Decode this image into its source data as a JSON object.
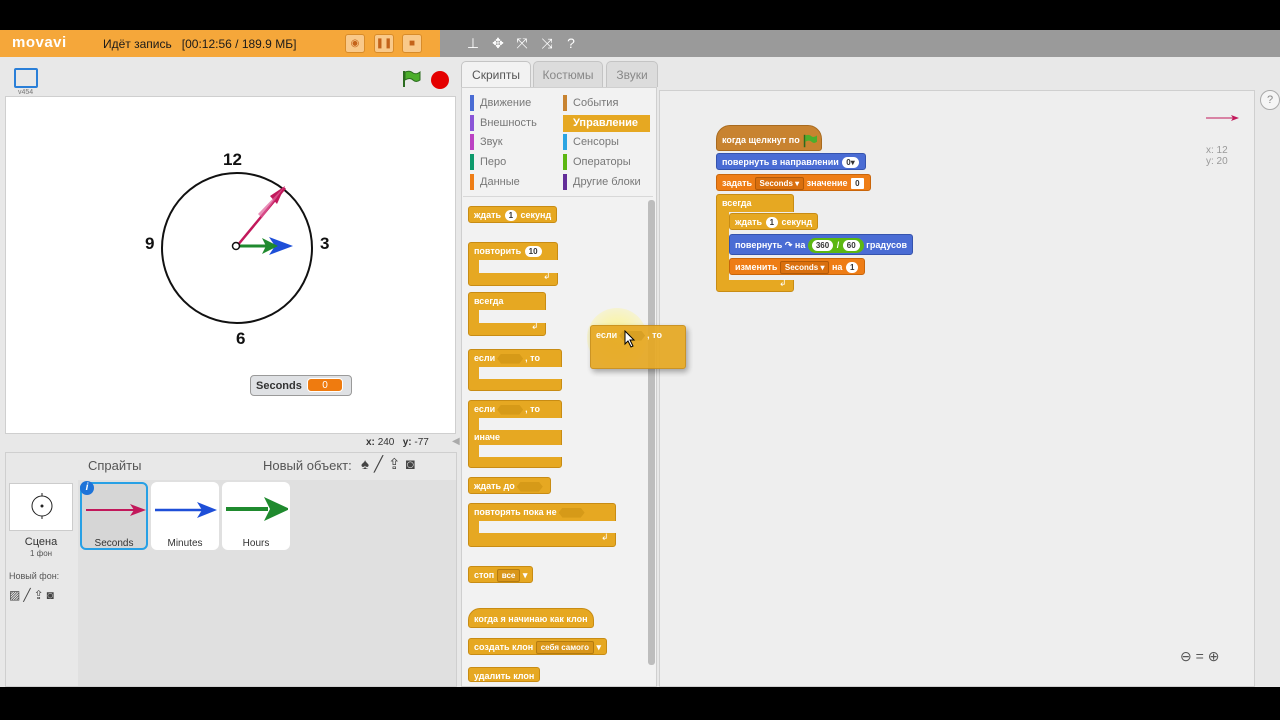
{
  "recorder": {
    "logo": "movavi",
    "status": "Идёт запись",
    "time_size": "[00:12:56 / 189.9 МБ]"
  },
  "stage": {
    "version": "v454",
    "clock": {
      "n12": "12",
      "n3": "3",
      "n6": "6",
      "n9": "9"
    },
    "monitor": {
      "name": "Seconds",
      "value": "0"
    },
    "mouse_x_label": "x:",
    "mouse_x": "240",
    "mouse_y_label": "y:",
    "mouse_y": "-77"
  },
  "sprites_pane": {
    "title": "Спрайты",
    "new_object": "Новый объект:",
    "scene_label": "Сцена",
    "scene_sub": "1 фон",
    "new_backdrop": "Новый фон:",
    "sprites": [
      {
        "name": "Seconds",
        "color": "#c2185b"
      },
      {
        "name": "Minutes",
        "color": "#1e4fd8"
      },
      {
        "name": "Hours",
        "color": "#1f8a2e"
      }
    ]
  },
  "tabs": [
    "Скрипты",
    "Костюмы",
    "Звуки"
  ],
  "categories": {
    "left": [
      {
        "label": "Движение",
        "color": "#4a6cd4"
      },
      {
        "label": "Внешность",
        "color": "#8a55d7"
      },
      {
        "label": "Звук",
        "color": "#bb42c3"
      },
      {
        "label": "Перо",
        "color": "#0e9a6c"
      },
      {
        "label": "Данные",
        "color": "#ee7d16"
      }
    ],
    "right": [
      {
        "label": "События",
        "color": "#c88330"
      },
      {
        "label": "Управление",
        "color": "#e6a822"
      },
      {
        "label": "Сенсоры",
        "color": "#2ca5e2"
      },
      {
        "label": "Операторы",
        "color": "#5cb712"
      },
      {
        "label": "Другие блоки",
        "color": "#632d99"
      }
    ]
  },
  "palette_blocks": {
    "wait": "ждать",
    "wait_val": "1",
    "wait_unit": "секунд",
    "repeat": "повторить",
    "repeat_val": "10",
    "forever": "всегда",
    "if": "если",
    "then": ", то",
    "else": "иначе",
    "wait_until": "ждать до",
    "repeat_until": "повторять пока не",
    "stop": "стоп",
    "stop_opt": "все",
    "when_clone": "когда я начинаю как клон",
    "create_clone": "создать клон",
    "create_clone_opt": "себя самого",
    "delete_clone": "удалить клон"
  },
  "dragged_block": {
    "if": "если",
    "then": ", то"
  },
  "script": {
    "hat": "когда щелкнут по",
    "point_dir": "повернуть в направлении",
    "point_dir_val": "0▾",
    "set_var": "задать",
    "set_var_name": "Seconds ▾",
    "set_var_mid": "значение",
    "set_var_val": "0",
    "forever": "всегда",
    "wait": "ждать",
    "wait_val": "1",
    "wait_unit": "секунд",
    "turn": "повернуть ↷ на",
    "turn_a": "360",
    "turn_op": "/",
    "turn_b": "60",
    "turn_unit": "градусов",
    "change": "изменить",
    "change_name": "Seconds ▾",
    "change_mid": "на",
    "change_val": "1"
  },
  "sprite_coords": {
    "x": "x: 12",
    "y": "y: 20"
  }
}
